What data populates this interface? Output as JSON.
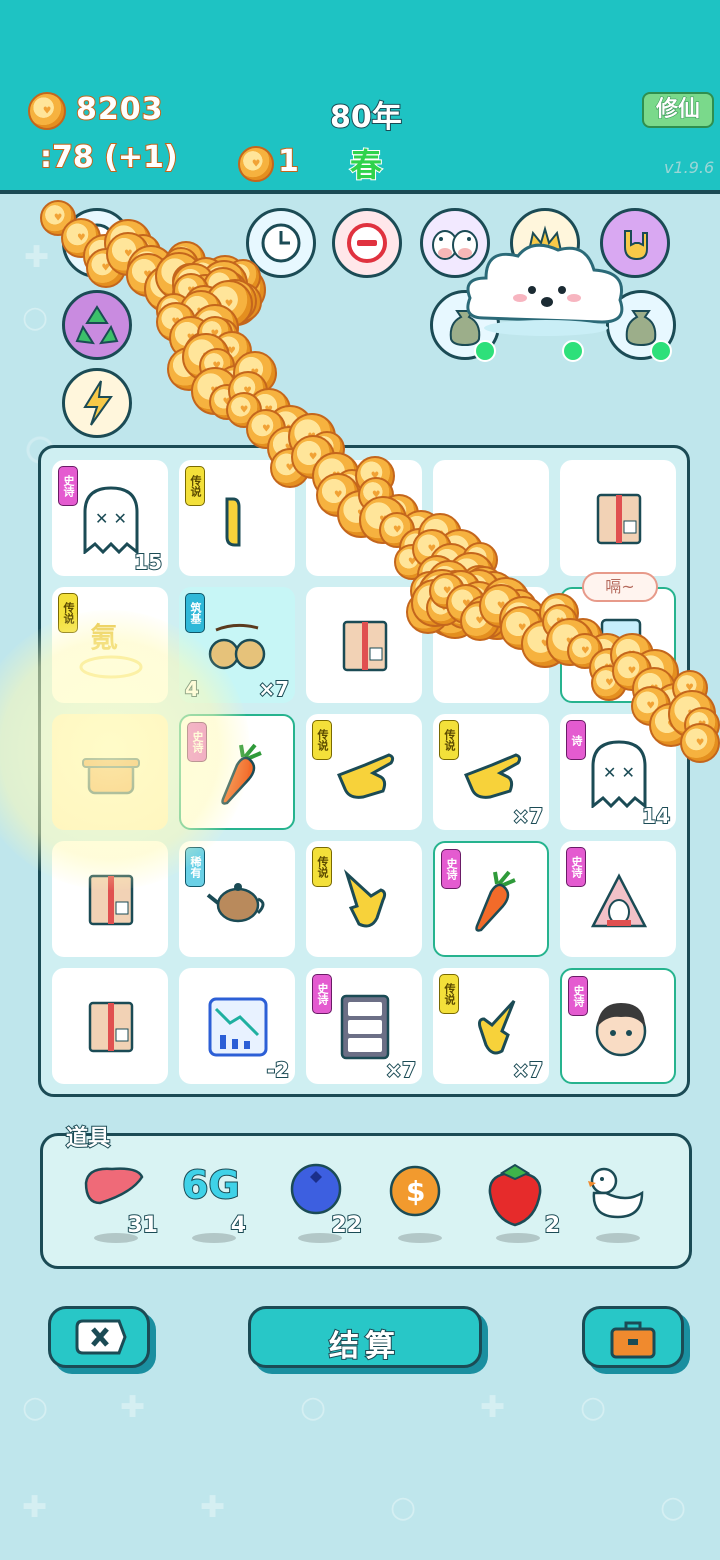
{
  "header": {
    "coins": "8203",
    "year": "80年",
    "season": "春",
    "income": ":78  (+1)",
    "secondary_count": "1",
    "cultivate_button": "修仙",
    "version": "v1.9.6"
  },
  "buffs": {
    "row1": [
      "clock-icon",
      "minus-icon",
      "cow-icon",
      "crown-icon",
      "rock-hand-icon"
    ],
    "row2": [
      "recycle-icon",
      "lightning-icon",
      "money-bag-icon",
      "money-bag-icon"
    ],
    "row3": [
      "lightning-icon"
    ]
  },
  "board": {
    "r0": [
      {
        "tag": "史诗",
        "item": "ghost",
        "qty": "15"
      },
      {
        "tag": "传说",
        "item": "pointing-hand",
        "qty": ""
      },
      {
        "tag": "",
        "item": "",
        "qty": ""
      },
      {
        "tag": "",
        "item": "",
        "qty": ""
      },
      {
        "tag": "",
        "item": "cardboard-box",
        "qty": ""
      }
    ],
    "r1": [
      {
        "tag": "传说",
        "item": "oxygen-tank",
        "qty": ""
      },
      {
        "tag": "筑基",
        "item": "gourds",
        "qty_left": "4",
        "qty": "×7"
      },
      {
        "tag": "",
        "item": "cardboard-box",
        "qty": ""
      },
      {
        "tag": "",
        "item": "",
        "qty": ""
      },
      {
        "tag": "",
        "item": "fridge",
        "qty": "",
        "bubble": "嗝~"
      }
    ],
    "r2": [
      {
        "tag": "",
        "item": "pot",
        "qty": ""
      },
      {
        "tag": "史诗",
        "item": "carrot",
        "qty": ""
      },
      {
        "tag": "传说",
        "item": "pointing-hand",
        "qty": ""
      },
      {
        "tag": "传说",
        "item": "pointing-hand",
        "qty": "×7"
      },
      {
        "tag": "诗",
        "item": "ghost",
        "qty": "14"
      }
    ],
    "r3": [
      {
        "tag": "",
        "item": "cardboard-box",
        "qty": ""
      },
      {
        "tag": "稀有",
        "item": "teapot",
        "qty": ""
      },
      {
        "tag": "传说",
        "item": "pointing-hand",
        "qty": ""
      },
      {
        "tag": "史诗",
        "item": "carrot",
        "qty": ""
      },
      {
        "tag": "史诗",
        "item": "rabbit-house",
        "qty": ""
      }
    ],
    "r4": [
      {
        "tag": "",
        "item": "cardboard-box",
        "qty": ""
      },
      {
        "tag": "",
        "item": "stock-down-chart",
        "qty": "-2"
      },
      {
        "tag": "史诗",
        "item": "server-rack",
        "qty": "×7"
      },
      {
        "tag": "传说",
        "item": "pointing-hand",
        "qty": "×7"
      },
      {
        "tag": "史诗",
        "item": "man-face",
        "qty": ""
      }
    ]
  },
  "props": {
    "title": "道具",
    "items": [
      {
        "name": "liver-icon",
        "count": "31"
      },
      {
        "name": "6g-icon",
        "label": "6G",
        "count": "4"
      },
      {
        "name": "blueberry-icon",
        "count": "22"
      },
      {
        "name": "coin-dollar-icon",
        "count": ""
      },
      {
        "name": "strawberry-icon",
        "count": "2"
      },
      {
        "name": "duck-icon",
        "count": ""
      }
    ]
  },
  "buttons": {
    "settle": "结算"
  },
  "colors": {
    "header_bg": "#1ec3c3",
    "body_bg": "#bfe6ec",
    "outline": "#1b4b55",
    "button": "#28c7c7",
    "coin": "#f6b23f",
    "epic_tag": "#e45bd0",
    "legend_tag": "#f3e03a"
  }
}
